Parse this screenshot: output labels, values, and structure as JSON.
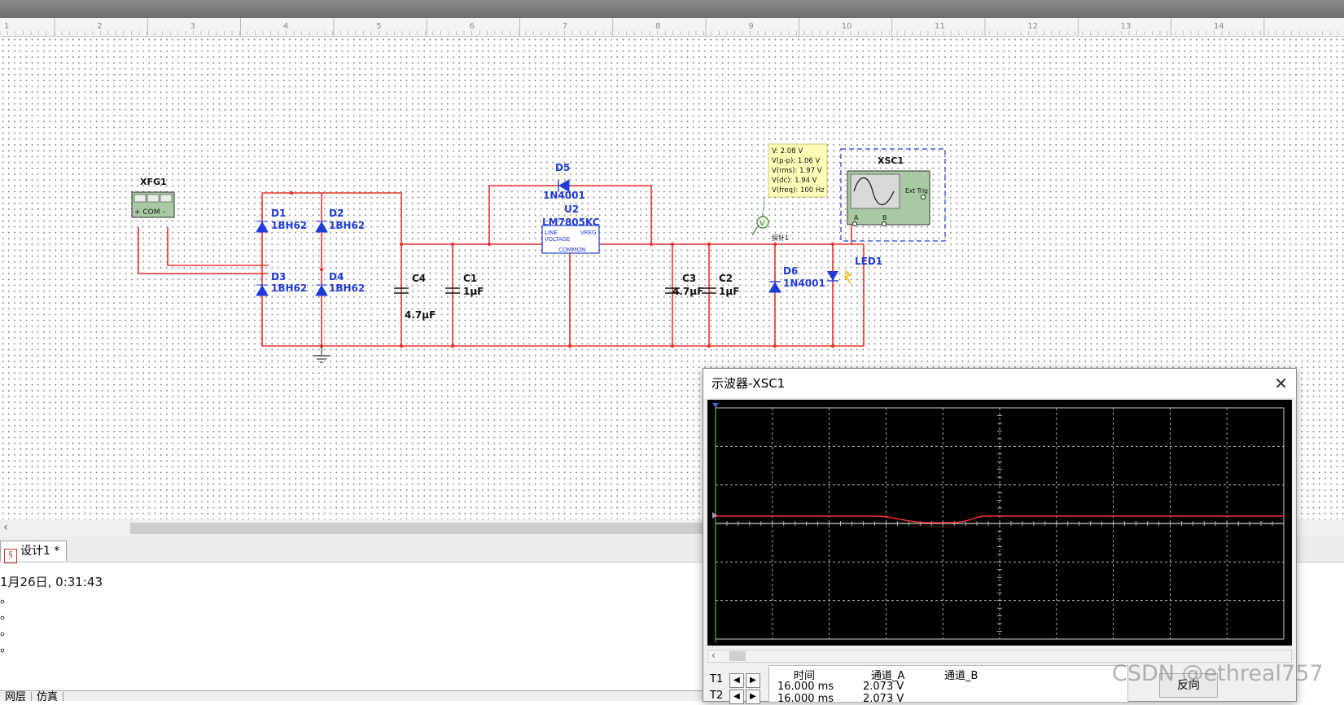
{
  "ruler": {
    "marks": [
      "1",
      "2",
      "3",
      "4",
      "5",
      "6",
      "7",
      "8",
      "9",
      "10",
      "11",
      "12",
      "13",
      "14"
    ]
  },
  "schematic": {
    "xfg": {
      "name": "XFG1",
      "terminals": "+ COM -"
    },
    "diodes": [
      {
        "ref": "D1",
        "model": "1BH62"
      },
      {
        "ref": "D2",
        "model": "1BH62"
      },
      {
        "ref": "D3",
        "model": "1BH62"
      },
      {
        "ref": "D4",
        "model": "1BH62"
      }
    ],
    "c4": {
      "ref": "C4",
      "value": "4.7µF"
    },
    "c1": {
      "ref": "C1",
      "value": "1µF"
    },
    "d5": {
      "ref": "D5",
      "model": "1N4001"
    },
    "u2": {
      "ref": "U2",
      "model": "LM7805KC",
      "pin_line": "LINE",
      "pin_vreg": "VREG",
      "pin_voltage": "VOLTAGE",
      "pin_common": "COMMON"
    },
    "c3": {
      "ref": "C3",
      "value": "4.7µF"
    },
    "c2": {
      "ref": "C2",
      "value": "1µF"
    },
    "d6": {
      "ref": "D6",
      "model": "1N4001"
    },
    "led": {
      "ref": "LED1"
    },
    "probe": {
      "label": "探针1",
      "lines": [
        "V: 2.08 V",
        "V(p-p): 1.06 V",
        "V(rms): 1.97 V",
        "V(dc): 1.94 V",
        "V(freq): 100 Hz"
      ]
    },
    "xsc": {
      "name": "XSC1",
      "ext_trig": "Ext Trig",
      "ch_a": "A",
      "ch_b": "B"
    }
  },
  "tabs": [
    {
      "label": "设计1 *"
    }
  ],
  "log": {
    "lines": [
      "1月26日, 0:31:43",
      "。",
      "。",
      "。",
      "。"
    ]
  },
  "bottom_tabs": [
    "网层",
    "仿真"
  ],
  "scope": {
    "title": "示波器-XSC1",
    "close": "✕",
    "readout": {
      "headers": [
        "时间",
        "通道_A",
        "通道_B"
      ],
      "t1": {
        "label": "T1",
        "time": "16.000 ms",
        "ch_a": "2.073 V",
        "ch_b": ""
      },
      "t2": {
        "label": "T2",
        "time": "16.000 ms",
        "ch_a": "2.073 V",
        "ch_b": ""
      }
    },
    "reverse_label": "反向",
    "trace_color": "#ff3030",
    "grid_color": "#cfcfcf"
  },
  "watermark": "CSDN @ethreal757"
}
